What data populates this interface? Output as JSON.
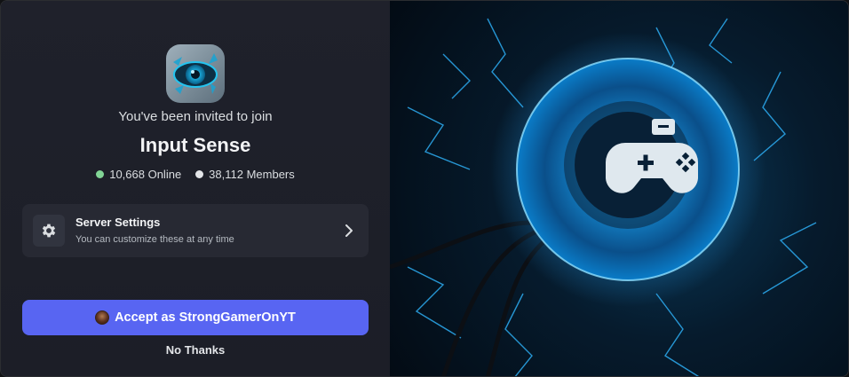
{
  "invite": {
    "heading": "You've been invited to join",
    "server_name": "Input Sense",
    "online_count": "10,668 Online",
    "member_count": "38,112 Members"
  },
  "settings": {
    "title": "Server Settings",
    "subtitle": "You can customize these at any time",
    "icon": "gear-icon"
  },
  "actions": {
    "accept_label": "Accept as StrongGamerOnYT",
    "decline_label": "No Thanks"
  },
  "colors": {
    "accent": "#5865f2",
    "online": "#82d596",
    "panel": "#1e1f2b"
  }
}
